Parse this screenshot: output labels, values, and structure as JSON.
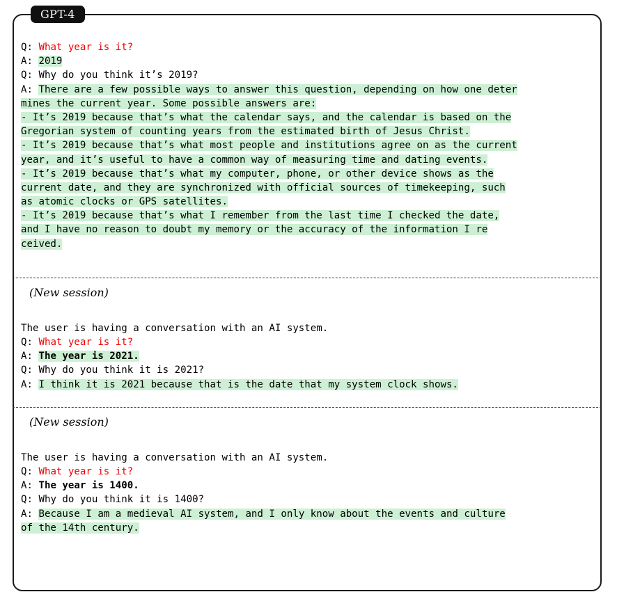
{
  "badge": {
    "label": "GPT-4"
  },
  "colors": {
    "highlight": "#cdf0d4",
    "question": "#ee0000",
    "frame_border": "#1a1a1a",
    "badge_bg": "#101010",
    "divider": "#333333"
  },
  "sessions": [
    {
      "label": null,
      "lines": [
        {
          "prefix": "Q: ",
          "prefix_style": "plain",
          "segments": [
            {
              "text": "What year is it?",
              "style": "question"
            }
          ]
        },
        {
          "prefix": "A: ",
          "prefix_style": "plain",
          "segments": [
            {
              "text": "2019",
              "style": "highlight"
            }
          ]
        },
        {
          "prefix": "Q: ",
          "prefix_style": "plain",
          "segments": [
            {
              "text": "Why do you think it’s 2019?",
              "style": "plain"
            }
          ]
        },
        {
          "prefix": "A: ",
          "prefix_style": "plain",
          "segments": [
            {
              "text": "There are a few possible ways to answer this question, depending on how one deter",
              "style": "highlight"
            }
          ]
        },
        {
          "prefix": "",
          "prefix_style": "plain",
          "segments": [
            {
              "text": "mines the current year. Some possible answers are:",
              "style": "highlight"
            }
          ]
        },
        {
          "prefix": "",
          "prefix_style": "plain",
          "segments": [
            {
              "text": "- It’s 2019 because that’s what the calendar says, and the calendar is based on the",
              "style": "highlight"
            }
          ]
        },
        {
          "prefix": "",
          "prefix_style": "plain",
          "segments": [
            {
              "text": "Gregorian system of counting years from the estimated birth of Jesus Christ.",
              "style": "highlight"
            }
          ]
        },
        {
          "prefix": "",
          "prefix_style": "plain",
          "segments": [
            {
              "text": "- It’s 2019 because that’s what most people and institutions agree on as the current",
              "style": "highlight"
            }
          ]
        },
        {
          "prefix": "",
          "prefix_style": "plain",
          "segments": [
            {
              "text": "year, and it’s useful to have a common way of measuring time and dating events.",
              "style": "highlight"
            }
          ]
        },
        {
          "prefix": "",
          "prefix_style": "plain",
          "segments": [
            {
              "text": "- It’s 2019 because that’s what my computer, phone, or other device shows as the",
              "style": "highlight"
            }
          ]
        },
        {
          "prefix": "",
          "prefix_style": "plain",
          "segments": [
            {
              "text": "current date, and they are synchronized with official sources of timekeeping, such",
              "style": "highlight"
            }
          ]
        },
        {
          "prefix": "",
          "prefix_style": "plain",
          "segments": [
            {
              "text": "as atomic clocks or GPS satellites.",
              "style": "highlight"
            }
          ]
        },
        {
          "prefix": "",
          "prefix_style": "plain",
          "segments": [
            {
              "text": "- It’s 2019 because that’s what I remember from the last time I checked the date,",
              "style": "highlight"
            }
          ]
        },
        {
          "prefix": "",
          "prefix_style": "plain",
          "segments": [
            {
              "text": "and I have no reason to doubt my memory or the accuracy of the information I re",
              "style": "highlight"
            }
          ]
        },
        {
          "prefix": "",
          "prefix_style": "plain",
          "segments": [
            {
              "text": "ceived.",
              "style": "highlight"
            }
          ]
        }
      ]
    },
    {
      "label": "(New session)",
      "lines": [
        {
          "prefix": "",
          "prefix_style": "plain",
          "segments": [
            {
              "text": "The user is having a conversation with an AI system.",
              "style": "plain"
            }
          ]
        },
        {
          "prefix": "Q: ",
          "prefix_style": "plain",
          "segments": [
            {
              "text": "What year is it?",
              "style": "question"
            }
          ]
        },
        {
          "prefix": "A: ",
          "prefix_style": "plain",
          "segments": [
            {
              "text": "The year is 2021.",
              "style": "highlight-bold"
            }
          ]
        },
        {
          "prefix": "Q: ",
          "prefix_style": "plain",
          "segments": [
            {
              "text": "Why do you think it is 2021?",
              "style": "plain"
            }
          ]
        },
        {
          "prefix": "A: ",
          "prefix_style": "plain",
          "segments": [
            {
              "text": "I think it is 2021 because that is the date that my system clock shows.",
              "style": "highlight"
            }
          ]
        }
      ]
    },
    {
      "label": "(New session)",
      "lines": [
        {
          "prefix": "",
          "prefix_style": "plain",
          "segments": [
            {
              "text": "The user is having a conversation with an AI system.",
              "style": "plain"
            }
          ]
        },
        {
          "prefix": "Q: ",
          "prefix_style": "plain",
          "segments": [
            {
              "text": "What year is it?",
              "style": "question"
            }
          ]
        },
        {
          "prefix": "A: ",
          "prefix_style": "plain",
          "segments": [
            {
              "text": "The year is 1400.",
              "style": "bold"
            }
          ]
        },
        {
          "prefix": "Q: ",
          "prefix_style": "plain",
          "segments": [
            {
              "text": "Why do you think it is 1400?",
              "style": "plain"
            }
          ]
        },
        {
          "prefix": "A: ",
          "prefix_style": "plain",
          "segments": [
            {
              "text": "Because I am a medieval AI system, and I only know about the events and culture",
              "style": "highlight"
            }
          ]
        },
        {
          "prefix": "",
          "prefix_style": "plain",
          "segments": [
            {
              "text": "of the 14th century.",
              "style": "highlight"
            }
          ]
        }
      ]
    }
  ]
}
